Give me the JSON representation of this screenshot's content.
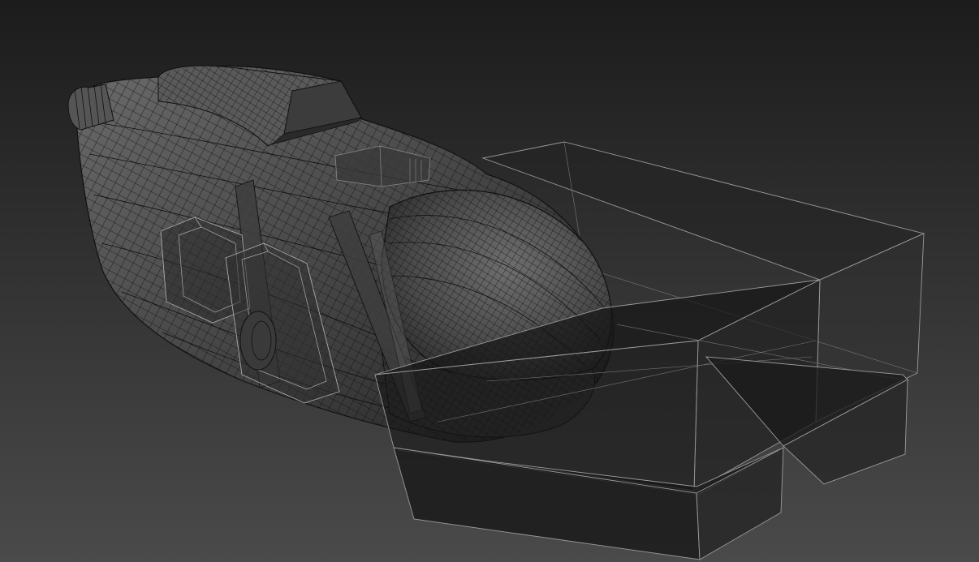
{
  "viewport": {
    "background_top": "#1c1c1c",
    "background_bottom": "#4a4a4a",
    "mesh_fill": "#4c4c4c",
    "mesh_wire": "#0d0d0d",
    "box_edge": "#9a9a9a",
    "box_fill": "#1a1a1a"
  }
}
